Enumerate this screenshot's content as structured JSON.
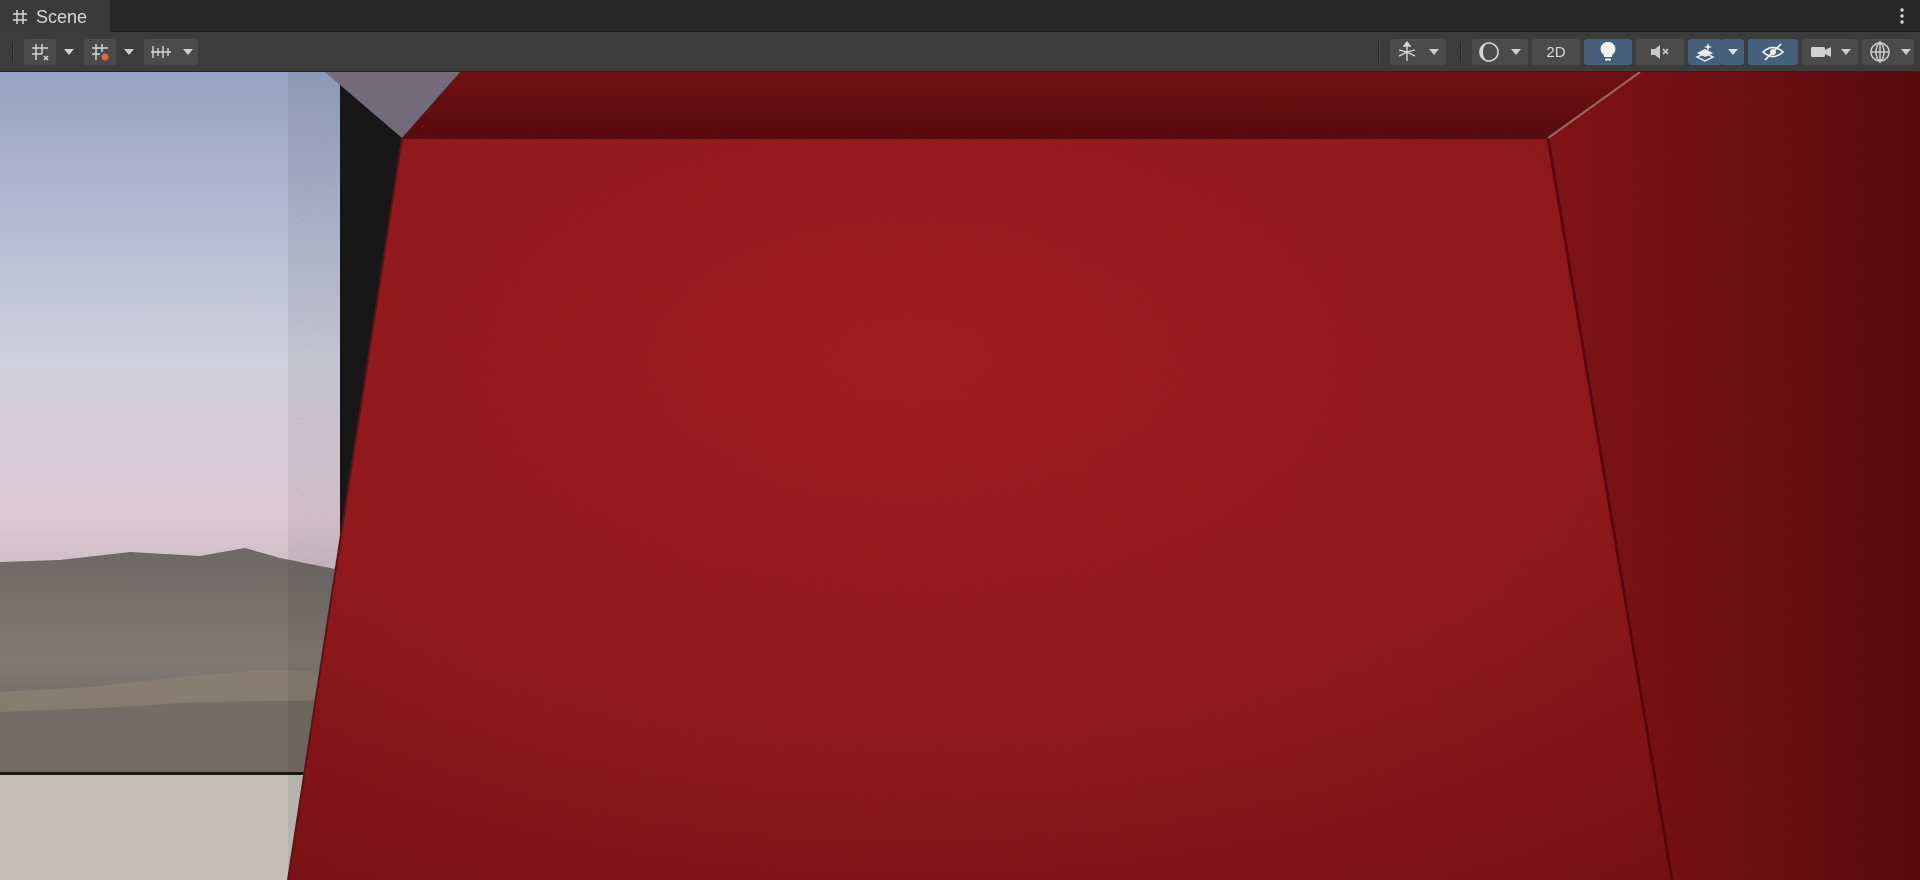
{
  "window": {
    "tab_title": "Scene",
    "tab_icon": "scene-grid-icon",
    "menu_icon": "kebab-menu-icon"
  },
  "toolbar": {
    "left": [
      {
        "name": "transform-tools-button",
        "icon": "grid-move-icon"
      },
      {
        "name": "grid-snapping-button",
        "icon": "grid-snap-icon"
      },
      {
        "name": "increment-snap-button",
        "icon": "ruler-snap-icon"
      }
    ],
    "right": {
      "orientation_icon": "axis-gizmo-icon",
      "draw_mode_icon": "shading-sphere-icon",
      "mode_2d_label": "2D",
      "lighting_icon": "lightbulb-icon",
      "lighting_active": true,
      "audio_icon": "audio-mute-icon",
      "effects_icon": "effects-layers-icon",
      "effects_active": true,
      "visibility_icon": "eye-hidden-icon",
      "visibility_active": true,
      "camera_icon": "camera-icon",
      "gizmos_icon": "gizmo-globe-icon"
    }
  },
  "colors": {
    "accent_active": "#46607c",
    "wall_red": "#a01a1e",
    "sky_top": "#9ba6c5",
    "sky_horizon": "#d9c9d2",
    "floor": "#c5bfba"
  }
}
